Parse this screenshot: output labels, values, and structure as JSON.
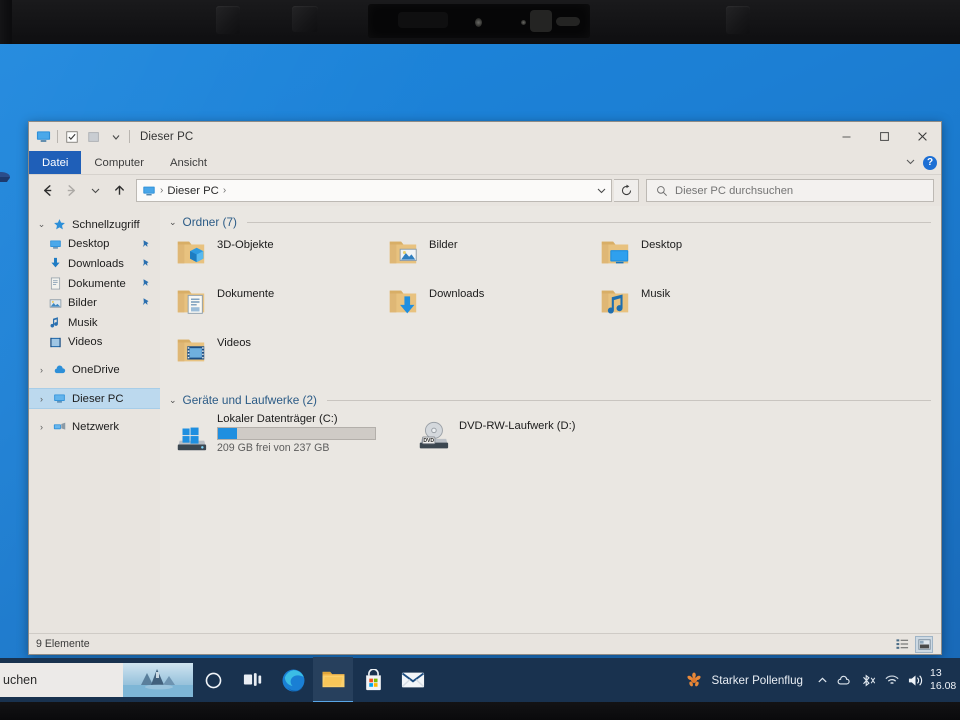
{
  "window": {
    "title": "Dieser PC",
    "quick_access": [
      "this-pc-icon",
      "properties-icon",
      "new-folder-icon",
      "customize-chevron"
    ],
    "controls": {
      "minimize": "—",
      "maximize": "☐",
      "close": "✕",
      "ribbon_collapse": "⌄",
      "help": "?"
    },
    "tabs": [
      {
        "label": "Datei",
        "active": true
      },
      {
        "label": "Computer",
        "active": false
      },
      {
        "label": "Ansicht",
        "active": false
      }
    ]
  },
  "navbar": {
    "back": "←",
    "forward": "→",
    "recent": "⌄",
    "up": "↑",
    "breadcrumb": [
      "Dieser PC"
    ],
    "breadcrumb_sep": "›",
    "dropdown": "⌄",
    "refresh": "⟳",
    "search_placeholder": "Dieser PC durchsuchen"
  },
  "nav_pane": [
    {
      "label": "Schnellzugriff",
      "icon": "star-icon",
      "chevron": "⌄",
      "indent": false,
      "pinned": false,
      "selected": false
    },
    {
      "label": "Desktop",
      "icon": "monitor-icon",
      "chevron": "",
      "indent": true,
      "pinned": true,
      "selected": false
    },
    {
      "label": "Downloads",
      "icon": "download-icon",
      "chevron": "",
      "indent": true,
      "pinned": true,
      "selected": false
    },
    {
      "label": "Dokumente",
      "icon": "document-icon",
      "chevron": "",
      "indent": true,
      "pinned": true,
      "selected": false
    },
    {
      "label": "Bilder",
      "icon": "picture-icon",
      "chevron": "",
      "indent": true,
      "pinned": true,
      "selected": false
    },
    {
      "label": "Musik",
      "icon": "music-icon",
      "chevron": "",
      "indent": true,
      "pinned": false,
      "selected": false
    },
    {
      "label": "Videos",
      "icon": "video-icon",
      "chevron": "",
      "indent": true,
      "pinned": false,
      "selected": false
    },
    {
      "label": "OneDrive",
      "icon": "cloud-icon",
      "chevron": "›",
      "indent": false,
      "pinned": false,
      "selected": false
    },
    {
      "label": "Dieser PC",
      "icon": "monitor-icon",
      "chevron": "›",
      "indent": false,
      "pinned": false,
      "selected": true
    },
    {
      "label": "Netzwerk",
      "icon": "network-icon",
      "chevron": "›",
      "indent": false,
      "pinned": false,
      "selected": false
    }
  ],
  "groups": {
    "folders": {
      "title": "Ordner (7)",
      "chevron": "⌄"
    },
    "drives": {
      "title": "Geräte und Laufwerke (2)",
      "chevron": "⌄"
    }
  },
  "folders": [
    {
      "name": "3D-Objekte",
      "icon": "folder-3d-objects"
    },
    {
      "name": "Bilder",
      "icon": "folder-pictures"
    },
    {
      "name": "Desktop",
      "icon": "folder-desktop"
    },
    {
      "name": "Dokumente",
      "icon": "folder-documents"
    },
    {
      "name": "Downloads",
      "icon": "folder-downloads"
    },
    {
      "name": "Musik",
      "icon": "folder-music"
    },
    {
      "name": "Videos",
      "icon": "folder-videos"
    }
  ],
  "drives": [
    {
      "name": "Lokaler Datenträger (C:)",
      "icon": "windows-drive-icon",
      "capacity_text": "209 GB frei von 237 GB",
      "free_gb": 209,
      "total_gb": 237,
      "used_percent": 12,
      "bar_color": "#1f8fe0"
    },
    {
      "name": "DVD-RW-Laufwerk (D:)",
      "icon": "dvd-drive-icon",
      "badge": "DVD"
    }
  ],
  "status_bar": {
    "count_text": "9 Elemente",
    "views": [
      "details-view-icon",
      "large-icons-view-icon"
    ]
  },
  "taskbar": {
    "search_text": "uchen",
    "buttons": [
      {
        "name": "cortana-button",
        "icon": "circle-icon",
        "active": false
      },
      {
        "name": "task-view-button",
        "icon": "task-view-icon",
        "active": false
      },
      {
        "name": "edge-button",
        "icon": "edge-icon",
        "active": false
      },
      {
        "name": "file-explorer-button",
        "icon": "folder-icon",
        "active": true
      },
      {
        "name": "microsoft-store-button",
        "icon": "store-icon",
        "active": false
      },
      {
        "name": "mail-button",
        "icon": "mail-icon",
        "active": false
      }
    ],
    "weather_text": "Starker Pollenflug",
    "weather_icon": "pollen-icon",
    "tray": [
      "show-hidden-icons-chevron",
      "onedrive-icon",
      "bluetooth-icon",
      "wifi-icon",
      "volume-icon"
    ],
    "clock_line1": "13",
    "clock_line2": "16.08"
  },
  "colors": {
    "desktop": "#1c7fd4",
    "accent": "#1f5fb8",
    "window_bg": "#e8e4df",
    "selection": "#bcd9ee",
    "taskbar": "#19324f",
    "drive_bar": "#1f8fe0"
  }
}
